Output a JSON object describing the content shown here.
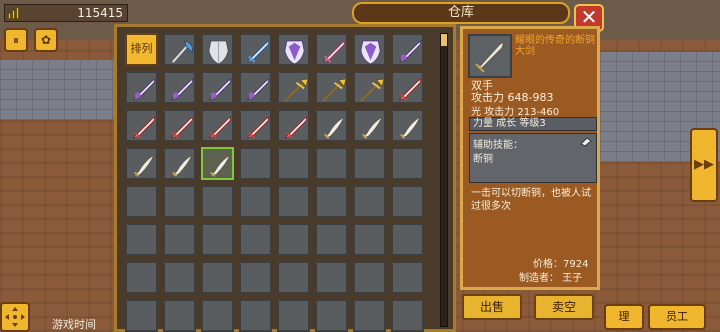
{
  "gold": {
    "amount": "115415"
  },
  "title": "仓库",
  "close_label": "✕",
  "sort_label": "排列",
  "detail": {
    "name": "耀眼的传奇的断铜大剑",
    "type": "双手",
    "attack": "攻击力  648-983",
    "light_attack": "光 攻击力  213-460",
    "stats_strip": "力量  成长  等级3",
    "skill_label": "辅助技能：",
    "skill_value": "断铜",
    "description": "一击可以切断铜，也被人试过很多次",
    "price": "价格：7924",
    "maker": "制造者：  王子"
  },
  "actions": {
    "sell": "出售",
    "empty": "卖空"
  },
  "game_time_label": "游戏时间",
  "bottom_right": {
    "b1": "理",
    "b2": "员工"
  },
  "colors": {
    "gold_accent": "#f0b62e",
    "panel_border": "#a87b2c",
    "detail_bg": "#9b5a22",
    "name_orange": "#f2a430"
  },
  "inventory": [
    {
      "item": "sort-button"
    },
    {
      "item": "axe-blue"
    },
    {
      "item": "shield-silver"
    },
    {
      "item": "sword-blue"
    },
    {
      "item": "shield-purple"
    },
    {
      "item": "sword-pink"
    },
    {
      "item": "shield-purple"
    },
    {
      "item": "sword-purple"
    },
    {
      "item": "sword-purple"
    },
    {
      "item": "sword-purple"
    },
    {
      "item": "sword-purple"
    },
    {
      "item": "sword-purple"
    },
    {
      "item": "spear-gold"
    },
    {
      "item": "spear-gold"
    },
    {
      "item": "spear-gold"
    },
    {
      "item": "sword-red"
    },
    {
      "item": "sword-red"
    },
    {
      "item": "sword-red"
    },
    {
      "item": "sword-red"
    },
    {
      "item": "sword-red"
    },
    {
      "item": "sword-red"
    },
    {
      "item": "blade-white"
    },
    {
      "item": "blade-white"
    },
    {
      "item": "blade-white"
    },
    {
      "item": "blade-white"
    },
    {
      "item": "blade-white"
    },
    {
      "item": "blade-white",
      "selected": true
    }
  ]
}
